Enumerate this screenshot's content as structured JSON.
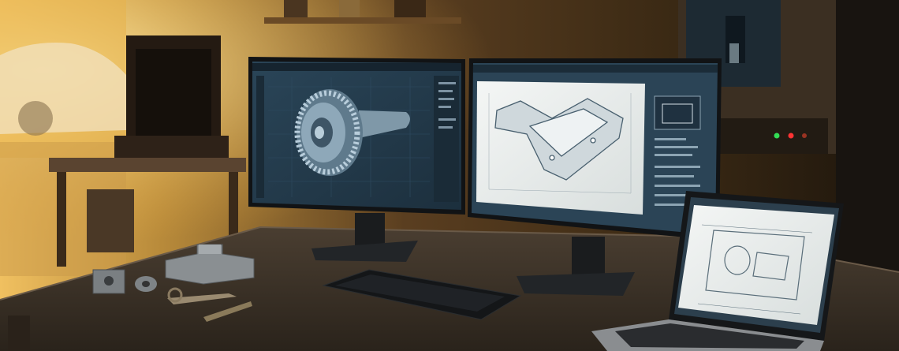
{
  "scene": {
    "description_tags": [
      "workshop",
      "dual-monitor-cad-workstation",
      "laptop",
      "machined-parts"
    ],
    "palette": {
      "window_glow": "#f2c35a",
      "wall_warm": "#6b4a24",
      "wall_dark": "#2a1e12",
      "desk_top": "#3a3127",
      "screen_ui": "#2f4a5c",
      "screen_dark": "#1f3140",
      "blueprint_paper": "#eef1f0",
      "cad_gear": "#9fb7c8",
      "led_green": "#33dd55",
      "led_red": "#ff3333"
    }
  },
  "monitors": {
    "left": {
      "content": "gear-shaft-3d-model",
      "theme": "dark-blue-cad"
    },
    "right": {
      "content": "bracket-part-drawing",
      "theme": "light-drawing-sheet"
    },
    "laptop": {
      "content": "2d-plate-drawing",
      "theme": "light-drawing-sheet"
    }
  }
}
